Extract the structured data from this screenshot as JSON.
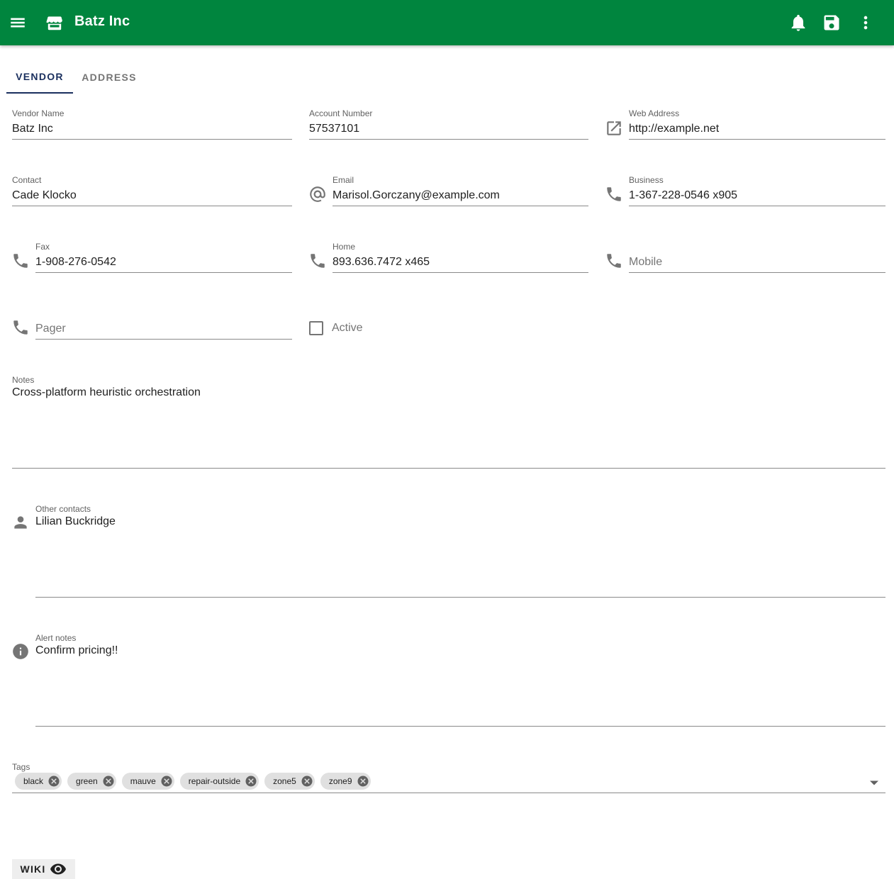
{
  "appbar": {
    "title": "Batz Inc",
    "icons": {
      "menu": "menu-icon",
      "store": "store-icon",
      "notifications": "bell-icon",
      "save": "save-icon",
      "more": "more-vert-icon"
    },
    "color": "#00853e"
  },
  "tabs": [
    {
      "label": "VENDOR",
      "active": true
    },
    {
      "label": "ADDRESS",
      "active": false
    }
  ],
  "fields": {
    "vendor_name": {
      "label": "Vendor Name",
      "value": "Batz Inc"
    },
    "account_number": {
      "label": "Account Number",
      "value": "57537101"
    },
    "web_address": {
      "label": "Web Address",
      "value": "http://example.net"
    },
    "contact": {
      "label": "Contact",
      "value": "Cade Klocko"
    },
    "email": {
      "label": "Email",
      "value": "Marisol.Gorczany@example.com"
    },
    "business": {
      "label": "Business",
      "value": "1-367-228-0546 x905"
    },
    "fax": {
      "label": "Fax",
      "value": "1-908-276-0542"
    },
    "home": {
      "label": "Home",
      "value": "893.636.7472 x465"
    },
    "mobile": {
      "placeholder": "Mobile",
      "value": ""
    },
    "pager": {
      "placeholder": "Pager",
      "value": ""
    },
    "active": {
      "label": "Active",
      "checked": false
    },
    "notes": {
      "label": "Notes",
      "value": "Cross-platform heuristic orchestration"
    },
    "other_contacts": {
      "label": "Other contacts",
      "value": "Lilian Buckridge"
    },
    "alert_notes": {
      "label": "Alert notes",
      "value": "Confirm pricing!!"
    }
  },
  "tags": {
    "label": "Tags",
    "items": [
      "black",
      "green",
      "mauve",
      "repair-outside",
      "zone5",
      "zone9"
    ]
  },
  "wiki": {
    "label": "WIKI"
  }
}
